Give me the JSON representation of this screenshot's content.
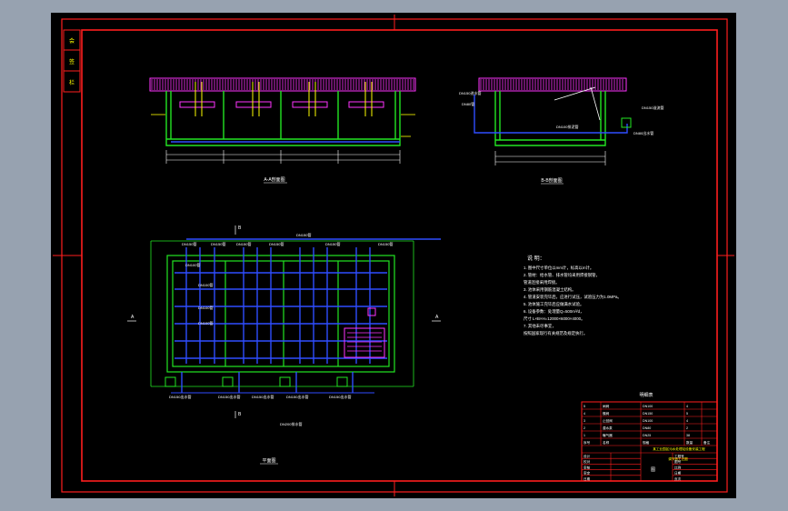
{
  "theme": {
    "viewport_bg": "#97a2b0",
    "sheet_bg": "#000000",
    "border": "#ff1e1e",
    "structure": "#22e622",
    "hatch": "#ff33ff",
    "pipe": "#2f4dff",
    "label": "#ffff00",
    "dimension": "#ffffff"
  },
  "views": {
    "section_aa_title": "A-A剖面图",
    "section_bb_title": "B-B剖面图",
    "plan_title": "平面图"
  },
  "notes": {
    "heading": "说  明：",
    "lines": [
      "1. 图中尺寸单位以mm计，标高以m计。",
      "2. 管材：给水管、排水管均采用焊接钢管，",
      "   管道连接采用焊接。",
      "3. 池体采用钢筋混凝土结构。",
      "4. 管道安装完毕后，应进行试压，试验压力为1.0MPa。",
      "5. 池体施工完毕后应做满水试验。",
      "6. 设备参数：处理量Q=500m³/d，",
      "   尺寸 L×B×H=12000×6000×4000。",
      "7. 其他未尽事宜，",
      "   按照国家现行有关规范及规定执行。"
    ]
  },
  "title_block": {
    "table_title": "明细表",
    "col_headers": [
      "序号",
      "名称",
      "规格",
      "数量",
      "备注"
    ],
    "rows": [
      [
        "5",
        "闸阀",
        "DN100",
        "4",
        ""
      ],
      [
        "4",
        "蝶阀",
        "DN150",
        "5",
        ""
      ],
      [
        "3",
        "止回阀",
        "DN100",
        "4",
        ""
      ],
      [
        "2",
        "潜水泵",
        "DN80",
        "2",
        ""
      ],
      [
        "1",
        "曝气器",
        "DN25",
        "38",
        ""
      ]
    ],
    "project_title": "某工业园区污水处理站设备安装工程",
    "drawing_name": "调节池工艺图",
    "sheet_label": "图",
    "stamp_rows": [
      "设计",
      "校对",
      "审核",
      "审定",
      "日期"
    ],
    "right_rows": [
      "工程号",
      "图号",
      "比例",
      "日期",
      "页次"
    ]
  },
  "side_strip": [
    "会",
    "签",
    "栏"
  ],
  "pipe_labels": {
    "top_mains": [
      "DN150管",
      "DN150管",
      "DN150管",
      "DN150管",
      "DN150管",
      "DN150管",
      "DN150管"
    ],
    "left_branches": [
      "DN100管",
      "DN100管",
      "DN100管",
      "DN100管"
    ],
    "bottom_outlets": [
      "DN150出水管",
      "DN150出水管",
      "DN150出水管",
      "DN150出水管",
      "DN150出水管"
    ],
    "outfall": "DN200排水管",
    "bb_labels": [
      "DN150进水管",
      "DN100排泥管",
      "DN80出水管",
      "DN150溢流管",
      "DN80管"
    ]
  },
  "section_markers": [
    "A",
    "A",
    "B",
    "B"
  ]
}
